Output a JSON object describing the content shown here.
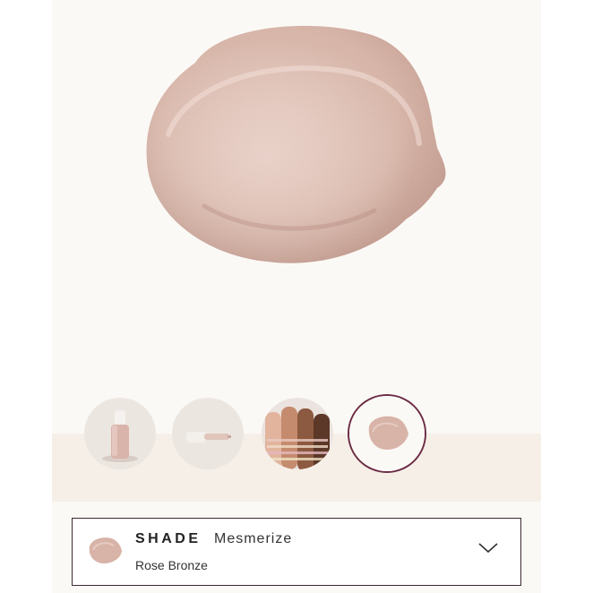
{
  "product": {
    "hero_image": "cream-swatch-swirl",
    "swatch_color": "#d9b2a6"
  },
  "gallery": {
    "thumbnails": [
      {
        "icon": "bottle-image",
        "selected": false
      },
      {
        "icon": "dropper-image",
        "selected": false
      },
      {
        "icon": "arm-swatches-image",
        "selected": false
      },
      {
        "icon": "cream-swatch-image",
        "selected": true
      }
    ],
    "selected_ring_color": "#6c2c44"
  },
  "shade_selector": {
    "label": "SHADE",
    "value": "Mesmerize",
    "subtitle": "Rose Bronze",
    "icon": "chevron-down-icon"
  }
}
